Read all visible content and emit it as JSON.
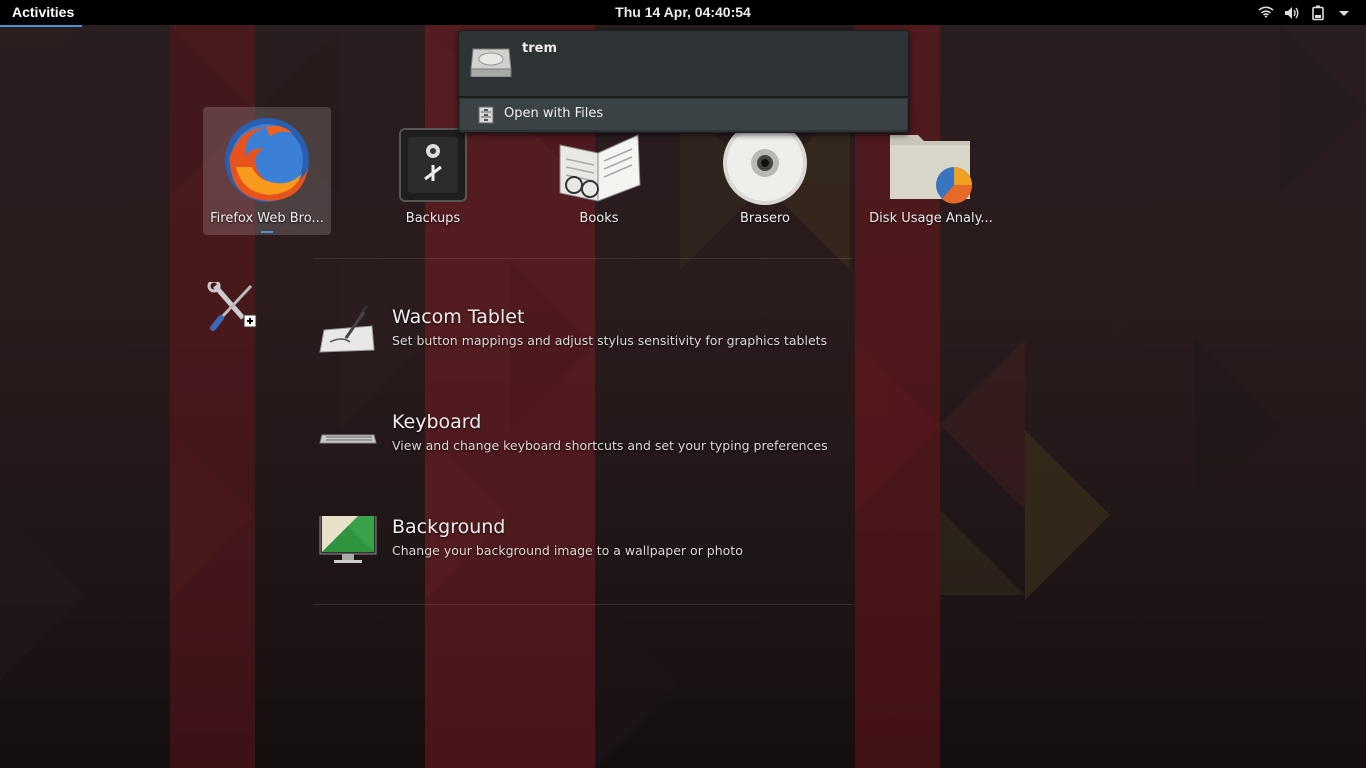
{
  "topbar": {
    "activities_label": "Activities",
    "clock": "Thu 14 Apr, 04:40:54",
    "tray_icons": [
      "wifi-icon",
      "volume-icon",
      "battery-icon",
      "dropdown-arrow-icon"
    ]
  },
  "apps": [
    {
      "label": "Firefox Web Bro...",
      "icon": "firefox-icon",
      "selected": true,
      "running": true
    },
    {
      "label": "Backups",
      "icon": "backups-safe-icon"
    },
    {
      "label": "Books",
      "icon": "books-icon"
    },
    {
      "label": "Brasero",
      "icon": "brasero-disc-icon"
    },
    {
      "label": "Disk Usage Analy...",
      "icon": "disk-usage-icon"
    }
  ],
  "settings_provider": {
    "icon": "settings-tools-icon"
  },
  "settings_results": [
    {
      "title": "Wacom Tablet",
      "description": "Set button mappings and adjust stylus sensitivity for graphics tablets",
      "icon": "wacom-tablet-icon"
    },
    {
      "title": "Keyboard",
      "description": "View and change keyboard shortcuts and set your typing preferences",
      "icon": "keyboard-icon"
    },
    {
      "title": "Background",
      "description": "Change your background image to a wallpaper or photo",
      "icon": "background-icon"
    }
  ],
  "popup": {
    "title": "trem",
    "items": [
      {
        "label": "Open with Files",
        "icon": "file-cabinet-icon"
      }
    ]
  },
  "colors": {
    "accent": "#4a90d9",
    "topbar": "#000000",
    "popup_bg": "#2e3436"
  }
}
